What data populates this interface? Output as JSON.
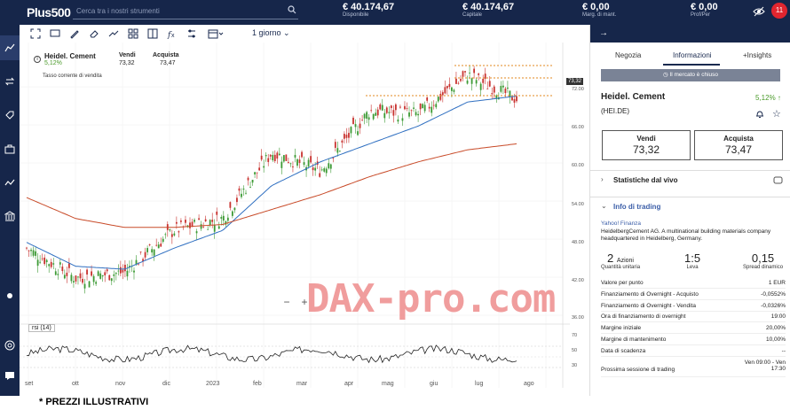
{
  "topbar": {
    "logo": "Plus500",
    "search_placeholder": "Cerca tra i nostri strumenti",
    "stats": [
      {
        "value": "€ 40.174,67",
        "label": "Disponibile"
      },
      {
        "value": "€ 40.174,67",
        "label": "Capitale"
      },
      {
        "value": "€ 0,00",
        "label": "Marg. di mant."
      },
      {
        "value": "€ 0,00",
        "label": "Prof/Per"
      }
    ],
    "notifications": "11"
  },
  "toolbar": {
    "period": "1 giorno"
  },
  "instrument_box": {
    "name": "Heidel. Cement",
    "change": "5,12%",
    "sell_label": "Vendi",
    "sell_value": "73,32",
    "buy_label": "Acquista",
    "buy_value": "73,47",
    "note": "Tasso corrente di vendita"
  },
  "chart": {
    "rsi_label": "rsi (14)",
    "watermark": "DAX-pro.com",
    "current_price_tag": "73,32",
    "x_labels": [
      "set",
      "ott",
      "nov",
      "dic",
      "2023",
      "feb",
      "mar",
      "apr",
      "mag",
      "giu",
      "lug",
      "ago"
    ],
    "y_labels": [
      "72.00",
      "66.00",
      "60.00",
      "54.00",
      "48.00",
      "42.00",
      "36.00"
    ],
    "rsi_levels": [
      "70",
      "50",
      "30"
    ]
  },
  "chart_data": {
    "type": "line",
    "title": "",
    "x": [
      "set",
      "ott",
      "nov",
      "dic",
      "2023",
      "feb",
      "mar",
      "apr",
      "mag",
      "giu",
      "lug",
      "ago"
    ],
    "series": [
      {
        "values": [
          46.5,
          41.5,
          42.5,
          49.5,
          51.5,
          62.5,
          59.5,
          69.5,
          69.0,
          75.5,
          71.5
        ]
      },
      {
        "values": [
          47.5,
          43.5,
          43.0,
          46.5,
          49.5,
          57.0,
          61.0,
          64.0,
          67.0,
          71.0,
          72.0
        ]
      },
      {
        "values": [
          55.0,
          51.5,
          50.0,
          50.0,
          50.5,
          53.0,
          55.5,
          58.5,
          61.0,
          63.0,
          64.0
        ]
      }
    ],
    "ylim": [
      35,
      78
    ],
    "grid": true
  },
  "panel": {
    "tabs": [
      "Negozia",
      "Informazioni",
      "+Insights"
    ],
    "market_closed": "Il mercato è chiuso",
    "name": "Heidel. Cement",
    "change": "5,12%",
    "code": "(HEI.DE)",
    "sell_label": "Vendi",
    "sell_value": "73,32",
    "buy_label": "Acquista",
    "buy_value": "73,47",
    "live_stats": "Statistiche dal vivo",
    "trading_info": "Info di trading",
    "source": "Yahoo! Finanza",
    "description": "HeidelbergCement AG. A multinational building materials company headquartered in Heidelberg, Germany.",
    "figures": [
      {
        "value": "2",
        "unit": "Azioni",
        "label": "Quantità unitaria"
      },
      {
        "value": "1:5",
        "unit": "",
        "label": "Leva"
      },
      {
        "value": "0,15",
        "unit": "",
        "label": "Spread dinamico"
      }
    ],
    "rows": [
      {
        "k": "Valore per punto",
        "v": "1 EUR"
      },
      {
        "k": "Finanziamento di Overnight - Acquisto",
        "v": "-0,0552%"
      },
      {
        "k": "Finanziamento di Overnight - Vendita",
        "v": "-0,0326%"
      },
      {
        "k": "Ora di finanziamento di overnight",
        "v": "19:00"
      },
      {
        "k": "Margine iniziale",
        "v": "20,00%"
      },
      {
        "k": "Margine di mantenimento",
        "v": "10,00%"
      },
      {
        "k": "Data di scadenza",
        "v": "--"
      },
      {
        "k": "Prossima sessione di trading",
        "v": "Ven 09:00 - Ven 17:30"
      }
    ]
  },
  "footer": "* PREZZI ILLUSTRATIVI"
}
